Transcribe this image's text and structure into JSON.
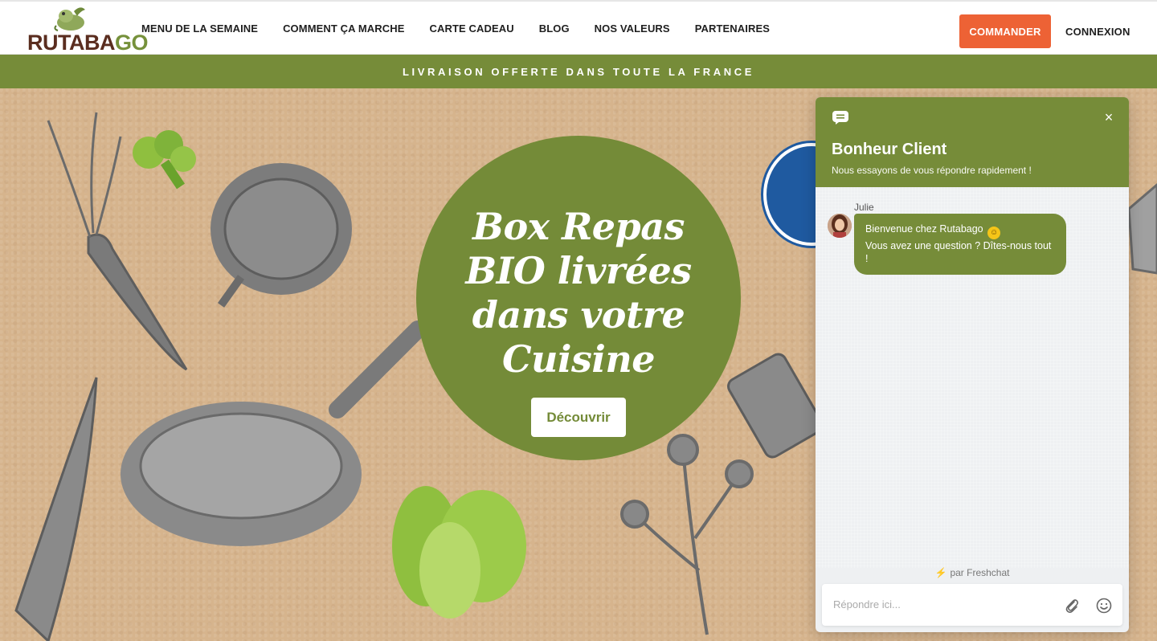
{
  "header": {
    "logo": {
      "part1": "RUTABA",
      "part2": "GO"
    },
    "nav": [
      "MENU DE LA SEMAINE",
      "COMMENT ÇA MARCHE",
      "CARTE CADEAU",
      "BLOG",
      "NOS VALEURS",
      "PARTENAIRES"
    ],
    "order_label": "COMMANDER",
    "login_label": "CONNEXION"
  },
  "banner": {
    "text": "LIVRAISON OFFERTE DANS TOUTE LA FRANCE"
  },
  "hero": {
    "title_lines": [
      "Box Repas",
      "BIO livrées",
      "dans votre",
      "Cuisine"
    ],
    "button_label": "Découvrir"
  },
  "chat": {
    "title": "Bonheur Client",
    "subtitle": "Nous essayons de vous répondre rapidement !",
    "agent_name": "Julie",
    "message_line1": "Bienvenue chez Rutabago",
    "message_line2": "Vous avez une question ? Dîtes-nous tout !",
    "powered_by": "par Freshchat",
    "input_placeholder": "Répondre ici...",
    "close_glyph": "×"
  },
  "colors": {
    "brand_green": "#768c39",
    "order_orange": "#ed6235",
    "logo_brown": "#5a2d1f",
    "kraft": "#d6b48d"
  }
}
